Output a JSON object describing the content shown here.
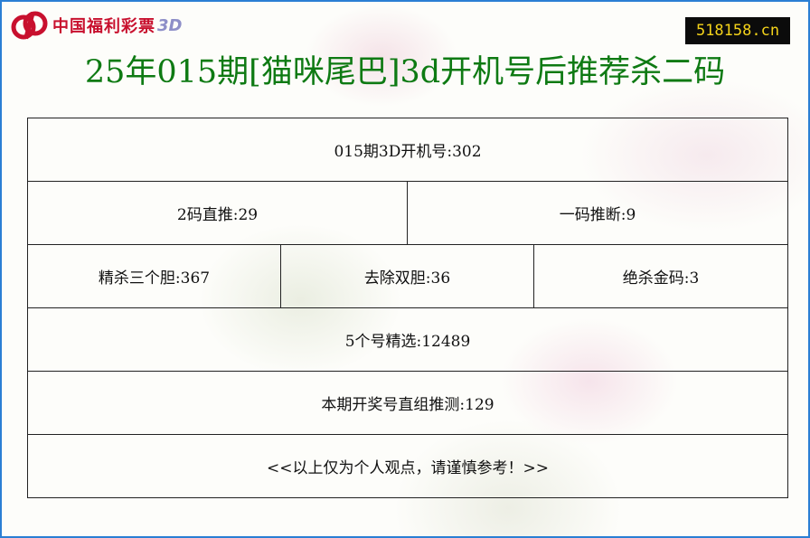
{
  "header": {
    "logo_text": "中国福利彩票",
    "logo_3d": "3D",
    "site_badge": "518158.cn"
  },
  "title": "25年015期[猫咪尾巴]3d开机号后推荐杀二码",
  "rows": {
    "open_number": "015期3D开机号:302",
    "two_direct": "2码直推:29",
    "one_judge": "一码推断:9",
    "kill_three": "精杀三个胆:367",
    "remove_double": "去除双胆:36",
    "kill_gold": "绝杀金码:3",
    "five_pick": "5个号精选:12489",
    "predict": "本期开奖号直组推测:129",
    "disclaimer": "<<以上仅为个人观点，请谨慎参考！>>"
  },
  "colors": {
    "border": "#2a7fd4",
    "title": "#0e7a13",
    "logo": "#c8102e",
    "badge_bg": "#0b0b0b",
    "badge_text": "#f3d21a"
  }
}
